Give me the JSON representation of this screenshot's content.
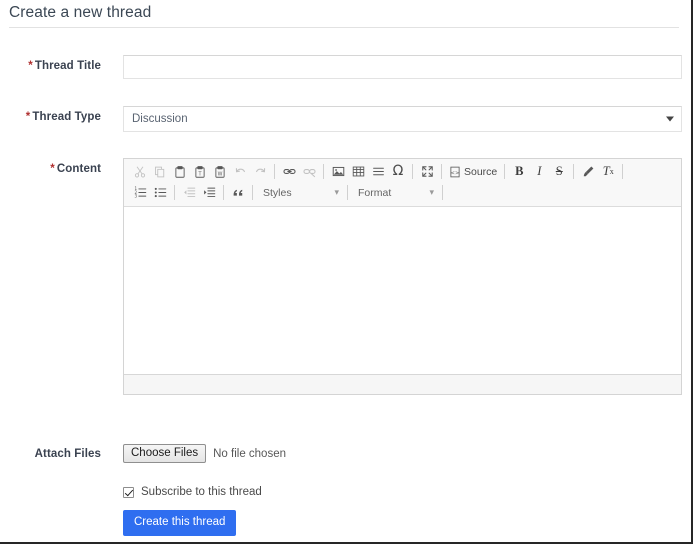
{
  "header": {
    "title": "Create a new thread"
  },
  "form": {
    "thread_title": {
      "label": "Thread Title",
      "required_marker": "*",
      "value": "",
      "placeholder": ""
    },
    "thread_type": {
      "label": "Thread Type",
      "required_marker": "*",
      "selected": "Discussion",
      "options": [
        "Discussion"
      ]
    },
    "content": {
      "label": "Content",
      "required_marker": "*",
      "body_text": ""
    },
    "attach_files": {
      "label": "Attach Files",
      "button_label": "Choose Files",
      "status_text": "No file chosen"
    },
    "subscribe": {
      "label": "Subscribe to this thread",
      "checked": true
    },
    "submit": {
      "label": "Create this thread"
    }
  },
  "editor_toolbar": {
    "row1": [
      {
        "name": "cut-icon",
        "title": "Cut",
        "disabled": true
      },
      {
        "name": "copy-icon",
        "title": "Copy",
        "disabled": true
      },
      {
        "name": "paste-icon",
        "title": "Paste",
        "disabled": false
      },
      {
        "name": "paste-text-icon",
        "title": "Paste as plain text",
        "disabled": false
      },
      {
        "name": "paste-word-icon",
        "title": "Paste from Word",
        "disabled": false
      },
      {
        "name": "undo-icon",
        "title": "Undo",
        "disabled": true
      },
      {
        "name": "redo-icon",
        "title": "Redo",
        "disabled": true
      },
      {
        "name": "link-icon",
        "title": "Link",
        "disabled": false
      },
      {
        "name": "unlink-icon",
        "title": "Unlink",
        "disabled": true
      },
      {
        "name": "image-icon",
        "title": "Image",
        "disabled": false
      },
      {
        "name": "table-icon",
        "title": "Table",
        "disabled": false
      },
      {
        "name": "horizontal-rule-icon",
        "title": "Horizontal Line",
        "disabled": false
      },
      {
        "name": "special-char-icon",
        "title": "Insert Special Character",
        "disabled": false
      },
      {
        "name": "maximize-icon",
        "title": "Maximize",
        "disabled": false
      },
      {
        "name": "source-button",
        "title": "Source",
        "disabled": false
      },
      {
        "name": "bold-icon",
        "title": "Bold",
        "disabled": false
      },
      {
        "name": "italic-icon",
        "title": "Italic",
        "disabled": false
      },
      {
        "name": "strikethrough-icon",
        "title": "Strikethrough",
        "disabled": false
      },
      {
        "name": "remove-format-icon",
        "title": "Remove Format",
        "disabled": false
      },
      {
        "name": "subscript-icon",
        "title": "Subscript",
        "disabled": false
      }
    ],
    "row2": [
      {
        "name": "numbered-list-icon",
        "title": "Insert/Remove Numbered List",
        "disabled": false
      },
      {
        "name": "bulleted-list-icon",
        "title": "Insert/Remove Bulleted List",
        "disabled": false
      },
      {
        "name": "outdent-icon",
        "title": "Decrease Indent",
        "disabled": true
      },
      {
        "name": "indent-icon",
        "title": "Increase Indent",
        "disabled": false
      },
      {
        "name": "blockquote-icon",
        "title": "Block Quote",
        "disabled": false
      }
    ],
    "source_label": "Source",
    "styles_label": "Styles",
    "format_label": "Format"
  },
  "colors": {
    "required_asterisk": "#b03030",
    "label_text": "#3a4250",
    "submit_button": "#2f6ef0",
    "toolbar_bg": "#f8f8f8",
    "editor_border": "#d4d4d4",
    "page_border": "#262626"
  }
}
